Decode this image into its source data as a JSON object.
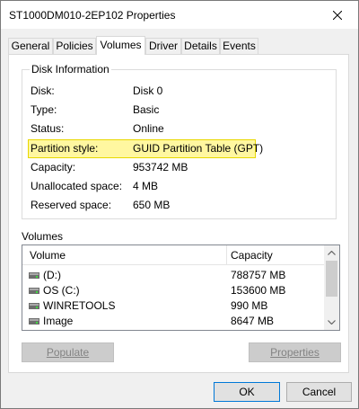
{
  "window": {
    "title": "ST1000DM010-2EP102 Properties"
  },
  "tabs": [
    {
      "label": "General",
      "active": false
    },
    {
      "label": "Policies",
      "active": false
    },
    {
      "label": "Volumes",
      "active": true
    },
    {
      "label": "Driver",
      "active": false
    },
    {
      "label": "Details",
      "active": false
    },
    {
      "label": "Events",
      "active": false
    }
  ],
  "disk_info": {
    "legend": "Disk Information",
    "rows": [
      {
        "label": "Disk:",
        "value": "Disk 0"
      },
      {
        "label": "Type:",
        "value": "Basic"
      },
      {
        "label": "Status:",
        "value": "Online"
      },
      {
        "label": "Partition style:",
        "value": "GUID Partition Table (GPT)",
        "highlighted": true
      },
      {
        "label": "Capacity:",
        "value": "953742 MB"
      },
      {
        "label": "Unallocated space:",
        "value": "4 MB"
      },
      {
        "label": "Reserved space:",
        "value": "650 MB"
      }
    ],
    "highlight_color": "#fff7a0"
  },
  "volumes": {
    "label": "Volumes",
    "columns": [
      "Volume",
      "Capacity"
    ],
    "rows": [
      {
        "volume": " (D:)",
        "capacity": "788757 MB"
      },
      {
        "volume": "OS (C:)",
        "capacity": "153600 MB"
      },
      {
        "volume": "WINRETOOLS",
        "capacity": "990 MB"
      },
      {
        "volume": "Image",
        "capacity": "8647 MB"
      }
    ]
  },
  "buttons": {
    "populate": "Populate",
    "properties": "Properties",
    "ok": "OK",
    "cancel": "Cancel"
  },
  "icons": {
    "close": "close-icon",
    "drive": "drive-icon",
    "scroll_up": "chevron-up-icon",
    "scroll_down": "chevron-down-icon"
  },
  "colors": {
    "accent": "#0078d7",
    "highlight_border": "#e8d800"
  }
}
